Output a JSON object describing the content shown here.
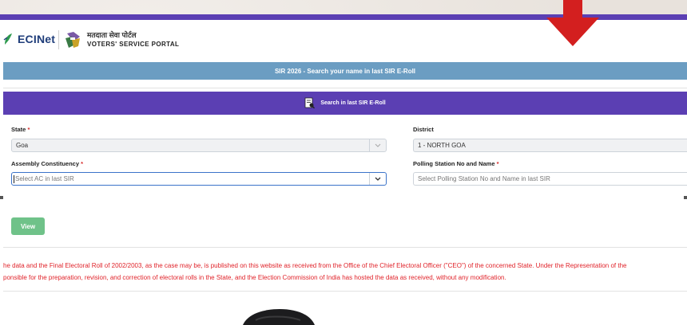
{
  "header": {
    "brand": "ECINet",
    "portal_hindi": "मतदाता सेवा पोर्टल",
    "portal_english": "VOTERS' SERVICE PORTAL"
  },
  "title_bar": {
    "text": "SIR 2026 - Search your name in last SIR E-Roll"
  },
  "search_bar": {
    "label": "Search in last SIR E-Roll"
  },
  "form": {
    "state": {
      "label": "State",
      "required_mark": "*",
      "value": "Goa"
    },
    "district": {
      "label": "District",
      "value": "1 - NORTH GOA"
    },
    "assembly": {
      "label": "Assembly Constituency",
      "required_mark": "*",
      "placeholder": "Select AC in last SIR"
    },
    "polling": {
      "label": "Polling Station No and Name",
      "required_mark": "*",
      "placeholder": "Select Polling Station No and Name in last SIR"
    },
    "view_label": "View"
  },
  "disclaimer": {
    "line1": "he data and the Final Electoral Roll of 2002/2003, as the case may be, is published on this website as received from the Office of the Chief Electoral Officer (\"CEO\") of the concerned State. Under the Representation of the",
    "line2": "ponsible for the preparation, revision, and correction of electoral rolls in the State, and the Election Commission of India has hosted the data as received, without any modification."
  },
  "colors": {
    "purple": "#5b3fb3",
    "title_blue": "#6b9dc2",
    "view_green": "#6fc289",
    "disclaimer_red": "#e0232a",
    "arrow_red": "#d31f1f"
  },
  "icons": {
    "brand": "leaf-icon",
    "emblem": "eci-emblem-icon",
    "search": "search-document-icon",
    "dropdown": "chevron-down-icon"
  }
}
